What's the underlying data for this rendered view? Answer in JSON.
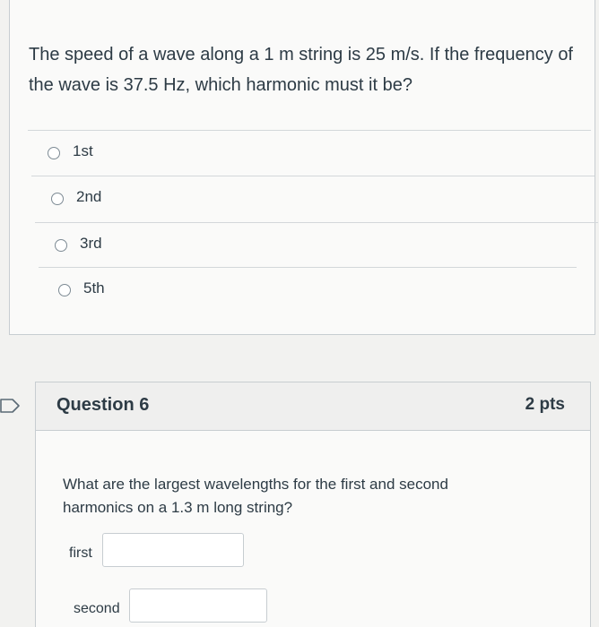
{
  "question5": {
    "text": "The speed of a wave along a 1 m string is 25 m/s. If the frequency of the wave is 37.5 Hz, which harmonic must it be?",
    "answers": [
      {
        "label": "1st",
        "selected": false
      },
      {
        "label": "2nd",
        "selected": false
      },
      {
        "label": "3rd",
        "selected": false
      },
      {
        "label": "5th",
        "selected": false
      }
    ]
  },
  "question6": {
    "title": "Question 6",
    "points": "2 pts",
    "text": "What are the largest wavelengths for the first and second harmonics on a 1.3 m long string?",
    "fields": [
      {
        "label": "first",
        "value": ""
      },
      {
        "label": "second",
        "value": ""
      }
    ],
    "flag_icon": "flag-icon"
  },
  "colors": {
    "text": "#2d3b45",
    "border": "#c7cdd1",
    "header_bg": "#efefee",
    "card_bg": "#fafaf9"
  }
}
